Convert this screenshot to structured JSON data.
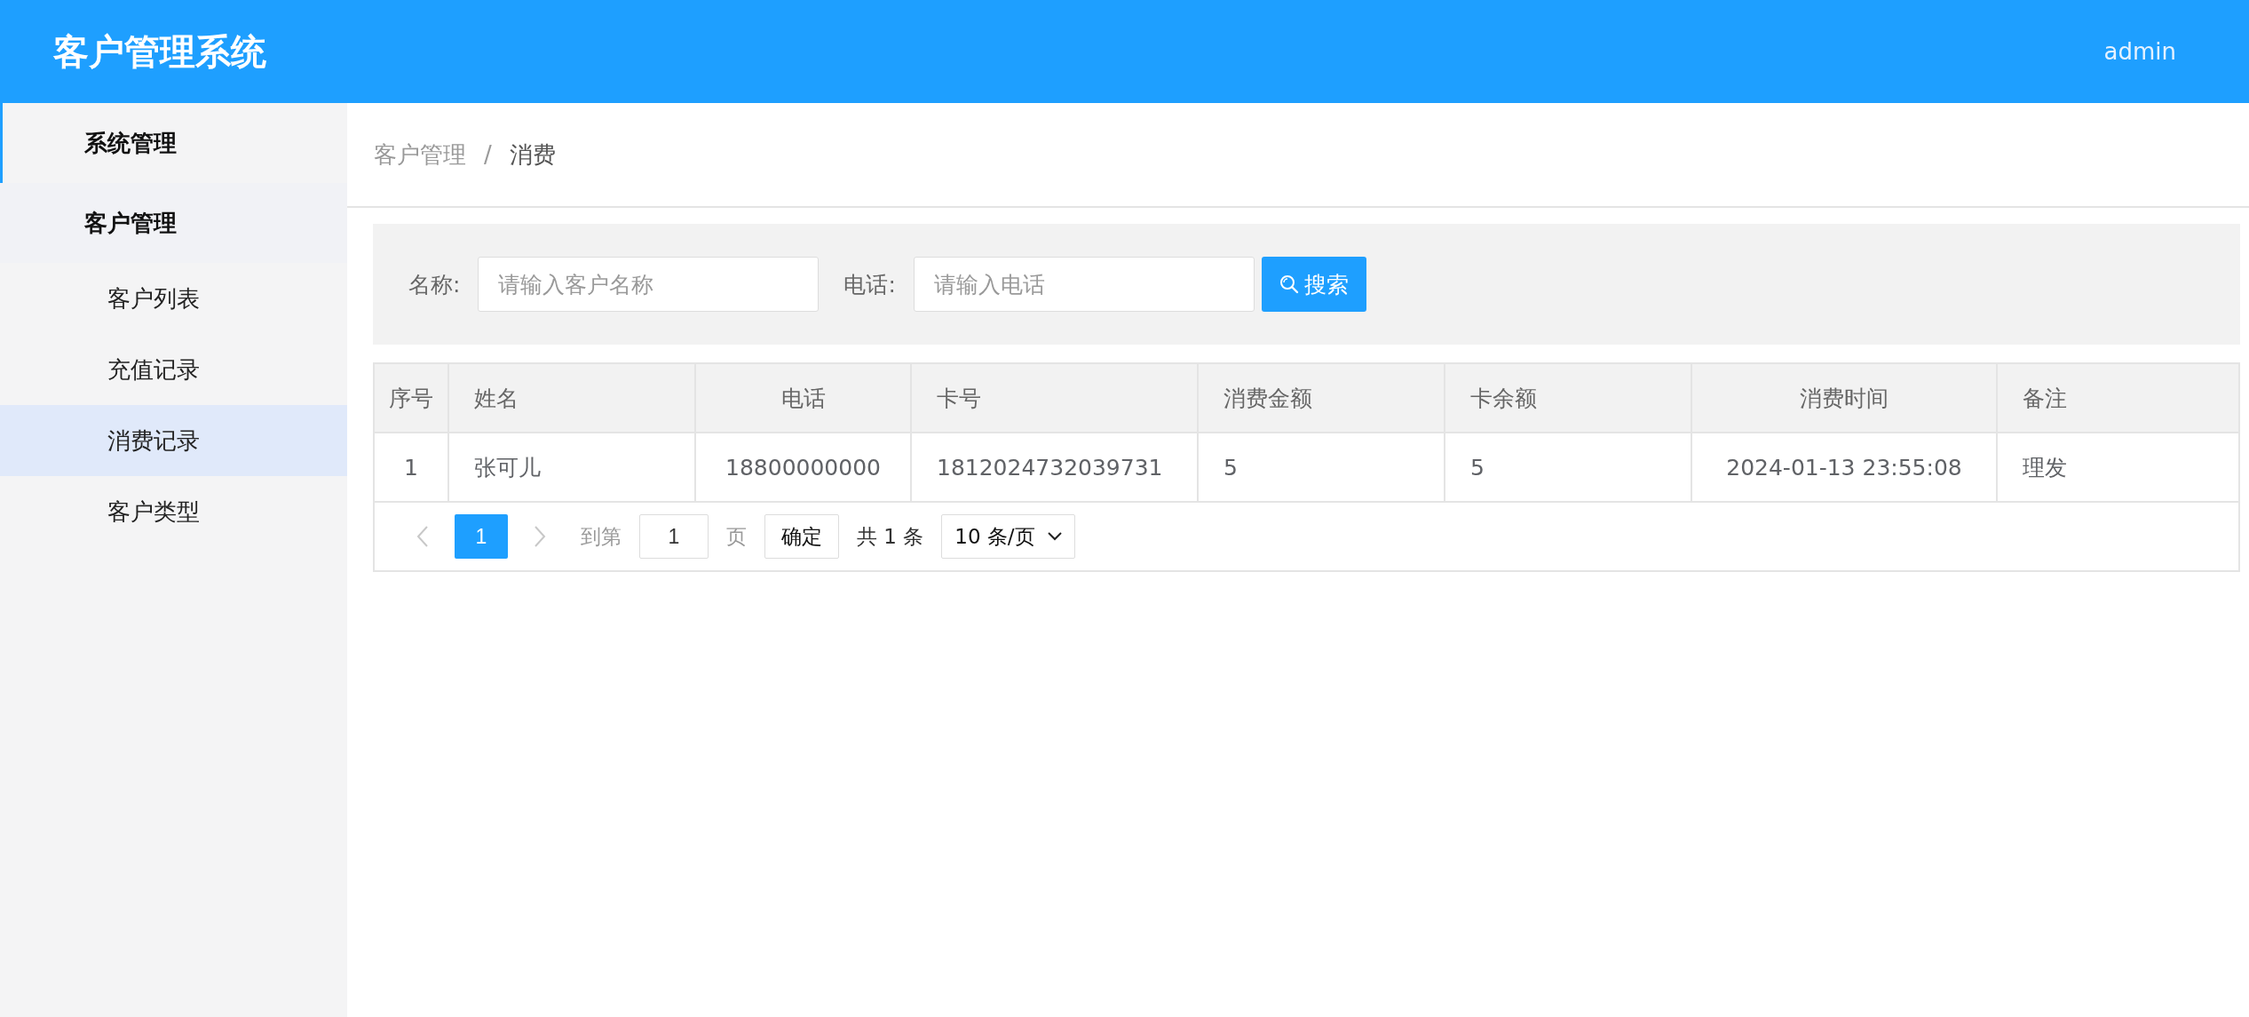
{
  "header": {
    "title": "客户管理系统",
    "user": "admin"
  },
  "sidebar": {
    "items": [
      {
        "label": "系统管理",
        "selected": true
      },
      {
        "label": "客户管理",
        "selected": false,
        "children": [
          {
            "label": "客户列表",
            "selected": false
          },
          {
            "label": "充值记录",
            "selected": false
          },
          {
            "label": "消费记录",
            "selected": true
          },
          {
            "label": "客户类型",
            "selected": false
          }
        ]
      }
    ]
  },
  "breadcrumb": [
    "客户管理",
    "/",
    "消费"
  ],
  "search": {
    "fields": [
      {
        "label": "名称:",
        "placeholder": "请输入客户名称"
      },
      {
        "label": "电话:",
        "placeholder": "请输入电话"
      }
    ],
    "button": "搜索"
  },
  "table": {
    "columns": [
      "序号",
      "姓名",
      "电话",
      "卡号",
      "消费金额",
      "卡余额",
      "消费时间",
      "备注"
    ],
    "rows": [
      [
        "1",
        "张可儿",
        "18800000000",
        "1812024732039731",
        "5",
        "5",
        "2024-01-13 23:55:08",
        "理发"
      ]
    ]
  },
  "pagination": {
    "prev_disabled": true,
    "next_disabled": true,
    "pages": [
      {
        "label": "1",
        "selected": true
      }
    ],
    "goto_label": "到第",
    "goto_value": "1",
    "page_unit": "页",
    "confirm": "确定",
    "total": "共 1 条",
    "page_size": "10 条/页"
  }
}
